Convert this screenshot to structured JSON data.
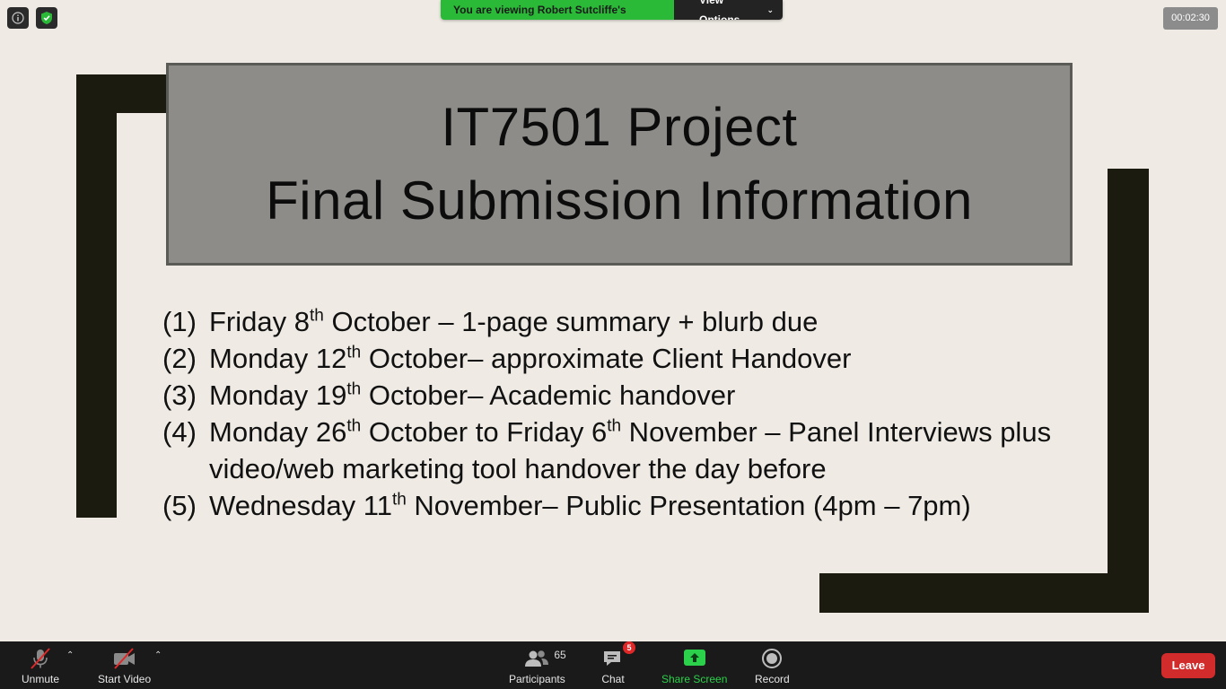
{
  "overlay": {
    "viewing_text": "You are viewing Robert Sutcliffe's screen",
    "view_options_label": "View Options",
    "timer": "00:02:30"
  },
  "slide": {
    "title_line1": "IT7501 Project",
    "title_line2": "Final Submission Information",
    "items": [
      {
        "num": "(1)",
        "pre": "Friday 8",
        "sup": "th",
        "post": " October – 1-page summary + blurb due"
      },
      {
        "num": "(2)",
        "pre": "Monday 12",
        "sup": "th",
        "post": " October– approximate Client Handover"
      },
      {
        "num": "(3)",
        "pre": "Monday 19",
        "sup": "th",
        "post": " October– Academic handover"
      },
      {
        "num": "(4)",
        "pre": "Monday 26",
        "sup": "th",
        "mid": " October to Friday 6",
        "sup2": "th",
        "post": " November – Panel Interviews plus video/web marketing tool handover the day before"
      },
      {
        "num": "(5)",
        "pre": "Wednesday 11",
        "sup": "th",
        "post": " November– Public Presentation (4pm – 7pm)"
      }
    ]
  },
  "toolbar": {
    "unmute_label": "Unmute",
    "start_video_label": "Start Video",
    "participants_label": "Participants",
    "participants_count": "65",
    "chat_label": "Chat",
    "chat_badge": "5",
    "share_screen_label": "Share Screen",
    "record_label": "Record",
    "leave_label": "Leave"
  },
  "colors": {
    "slide_bg": "#efebe4",
    "bracket": "#1b1b10",
    "title_box": "#8d8c88",
    "viewing_bar": "#2aba38",
    "share_green": "#2bd14a",
    "leave_red": "#d12b2b"
  }
}
